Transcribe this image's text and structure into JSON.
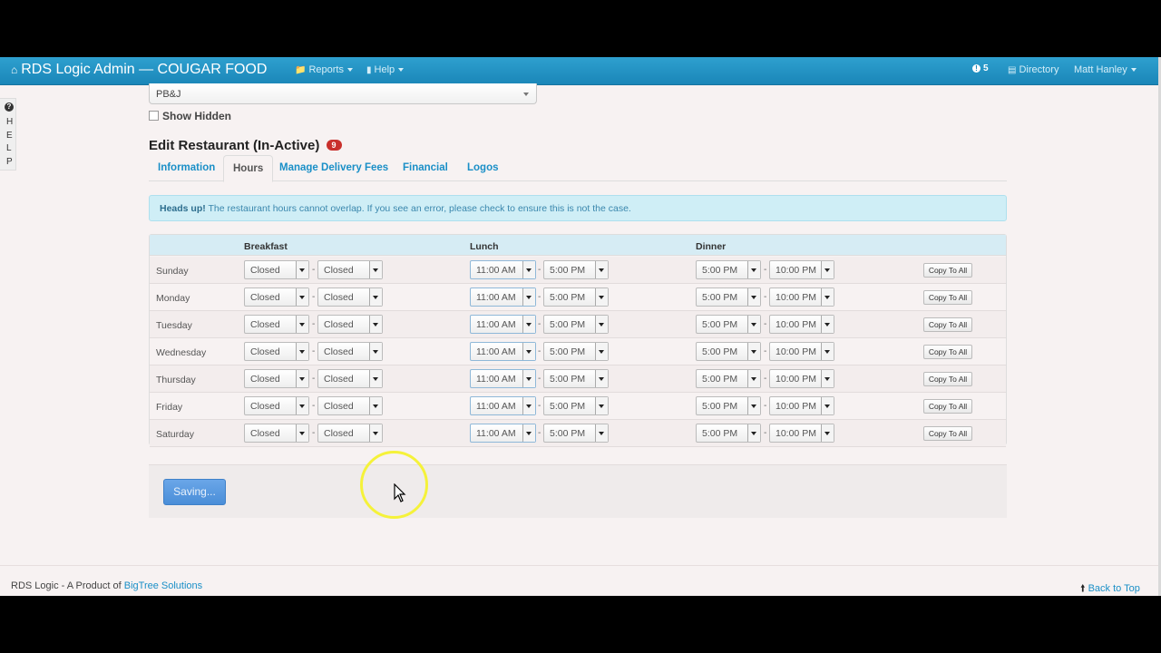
{
  "navbar": {
    "brand": "RDS Logic Admin — COUGAR FOOD",
    "reports": "Reports",
    "help": "Help",
    "alerts_count": "5",
    "directory": "Directory",
    "user": "Matt Hanley"
  },
  "help_tab": {
    "letters": [
      "H",
      "E",
      "L",
      "P"
    ]
  },
  "restaurant_select": {
    "value": "PB&J"
  },
  "show_hidden_label": "Show Hidden",
  "page": {
    "title": "Edit Restaurant (In-Active)",
    "badge": "9"
  },
  "tabs": [
    {
      "label": "Information",
      "active": false
    },
    {
      "label": "Hours",
      "active": true
    },
    {
      "label": "Manage Delivery Fees",
      "active": false
    },
    {
      "label": "Financial",
      "active": false
    },
    {
      "label": "Logos",
      "active": false
    }
  ],
  "alert": {
    "strong": "Heads up!",
    "text": " The restaurant hours cannot overlap. If you see an error, please check to ensure this is not the case."
  },
  "hours": {
    "headers": {
      "breakfast": "Breakfast",
      "lunch": "Lunch",
      "dinner": "Dinner"
    },
    "copy_label": "Copy To All",
    "rows": [
      {
        "day": "Sunday",
        "breakfast": [
          "Closed",
          "Closed"
        ],
        "lunch": [
          "11:00 AM",
          "5:00 PM"
        ],
        "dinner": [
          "5:00 PM",
          "10:00 PM"
        ]
      },
      {
        "day": "Monday",
        "breakfast": [
          "Closed",
          "Closed"
        ],
        "lunch": [
          "11:00 AM",
          "5:00 PM"
        ],
        "dinner": [
          "5:00 PM",
          "10:00 PM"
        ]
      },
      {
        "day": "Tuesday",
        "breakfast": [
          "Closed",
          "Closed"
        ],
        "lunch": [
          "11:00 AM",
          "5:00 PM"
        ],
        "dinner": [
          "5:00 PM",
          "10:00 PM"
        ]
      },
      {
        "day": "Wednesday",
        "breakfast": [
          "Closed",
          "Closed"
        ],
        "lunch": [
          "11:00 AM",
          "5:00 PM"
        ],
        "dinner": [
          "5:00 PM",
          "10:00 PM"
        ]
      },
      {
        "day": "Thursday",
        "breakfast": [
          "Closed",
          "Closed"
        ],
        "lunch": [
          "11:00 AM",
          "5:00 PM"
        ],
        "dinner": [
          "5:00 PM",
          "10:00 PM"
        ]
      },
      {
        "day": "Friday",
        "breakfast": [
          "Closed",
          "Closed"
        ],
        "lunch": [
          "11:00 AM",
          "5:00 PM"
        ],
        "dinner": [
          "5:00 PM",
          "10:00 PM"
        ]
      },
      {
        "day": "Saturday",
        "breakfast": [
          "Closed",
          "Closed"
        ],
        "lunch": [
          "11:00 AM",
          "5:00 PM"
        ],
        "dinner": [
          "5:00 PM",
          "10:00 PM"
        ]
      }
    ]
  },
  "save_button": "Saving...",
  "footer": {
    "prefix": "RDS Logic - A Product of ",
    "link": "BigTree Solutions",
    "back_to_top": "Back to Top"
  },
  "colors": {
    "navbar": "#1a86b8",
    "link": "#1a8fc7",
    "badge": "#c9302c",
    "save_button": "#4a8ed8",
    "cursor_highlight": "#f5f23a"
  }
}
